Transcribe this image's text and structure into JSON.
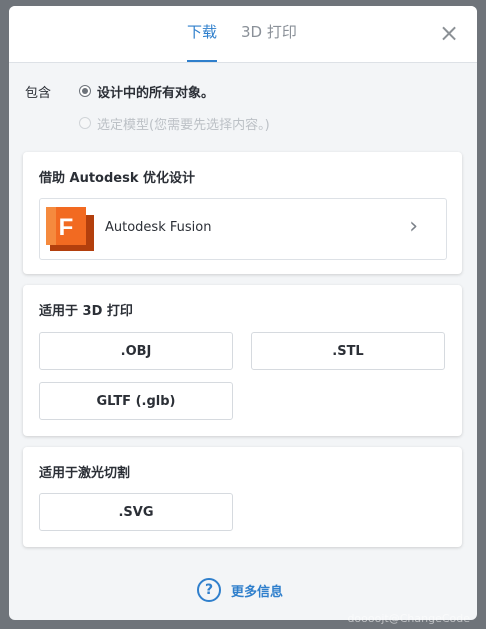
{
  "tabs": [
    {
      "label": "下载",
      "active": true
    },
    {
      "label": "3D 打印",
      "active": false
    }
  ],
  "close_symbol": "×",
  "include": {
    "label": "包含",
    "options": [
      {
        "label": "设计中的所有对象。",
        "checked": true,
        "disabled": false
      },
      {
        "label": "选定模型(您需要先选择内容。)",
        "checked": false,
        "disabled": true
      }
    ]
  },
  "fusion_card": {
    "title": "借助 Autodesk 优化设计",
    "app_name": "Autodesk Fusion",
    "logo_letter": "F",
    "chevron": "›"
  },
  "print_card": {
    "title": "适用于 3D 打印",
    "buttons": [
      ".OBJ",
      ".STL",
      "GLTF (.glb)"
    ]
  },
  "laser_card": {
    "title": "适用于激光切割",
    "buttons": [
      ".SVG"
    ]
  },
  "more_info": {
    "label": "更多信息",
    "icon_glyph": "?"
  },
  "watermark": "doooojt@ChangeCode",
  "colors": {
    "accent": "#2f7fcc",
    "fusion_orange": "#f26a21"
  }
}
